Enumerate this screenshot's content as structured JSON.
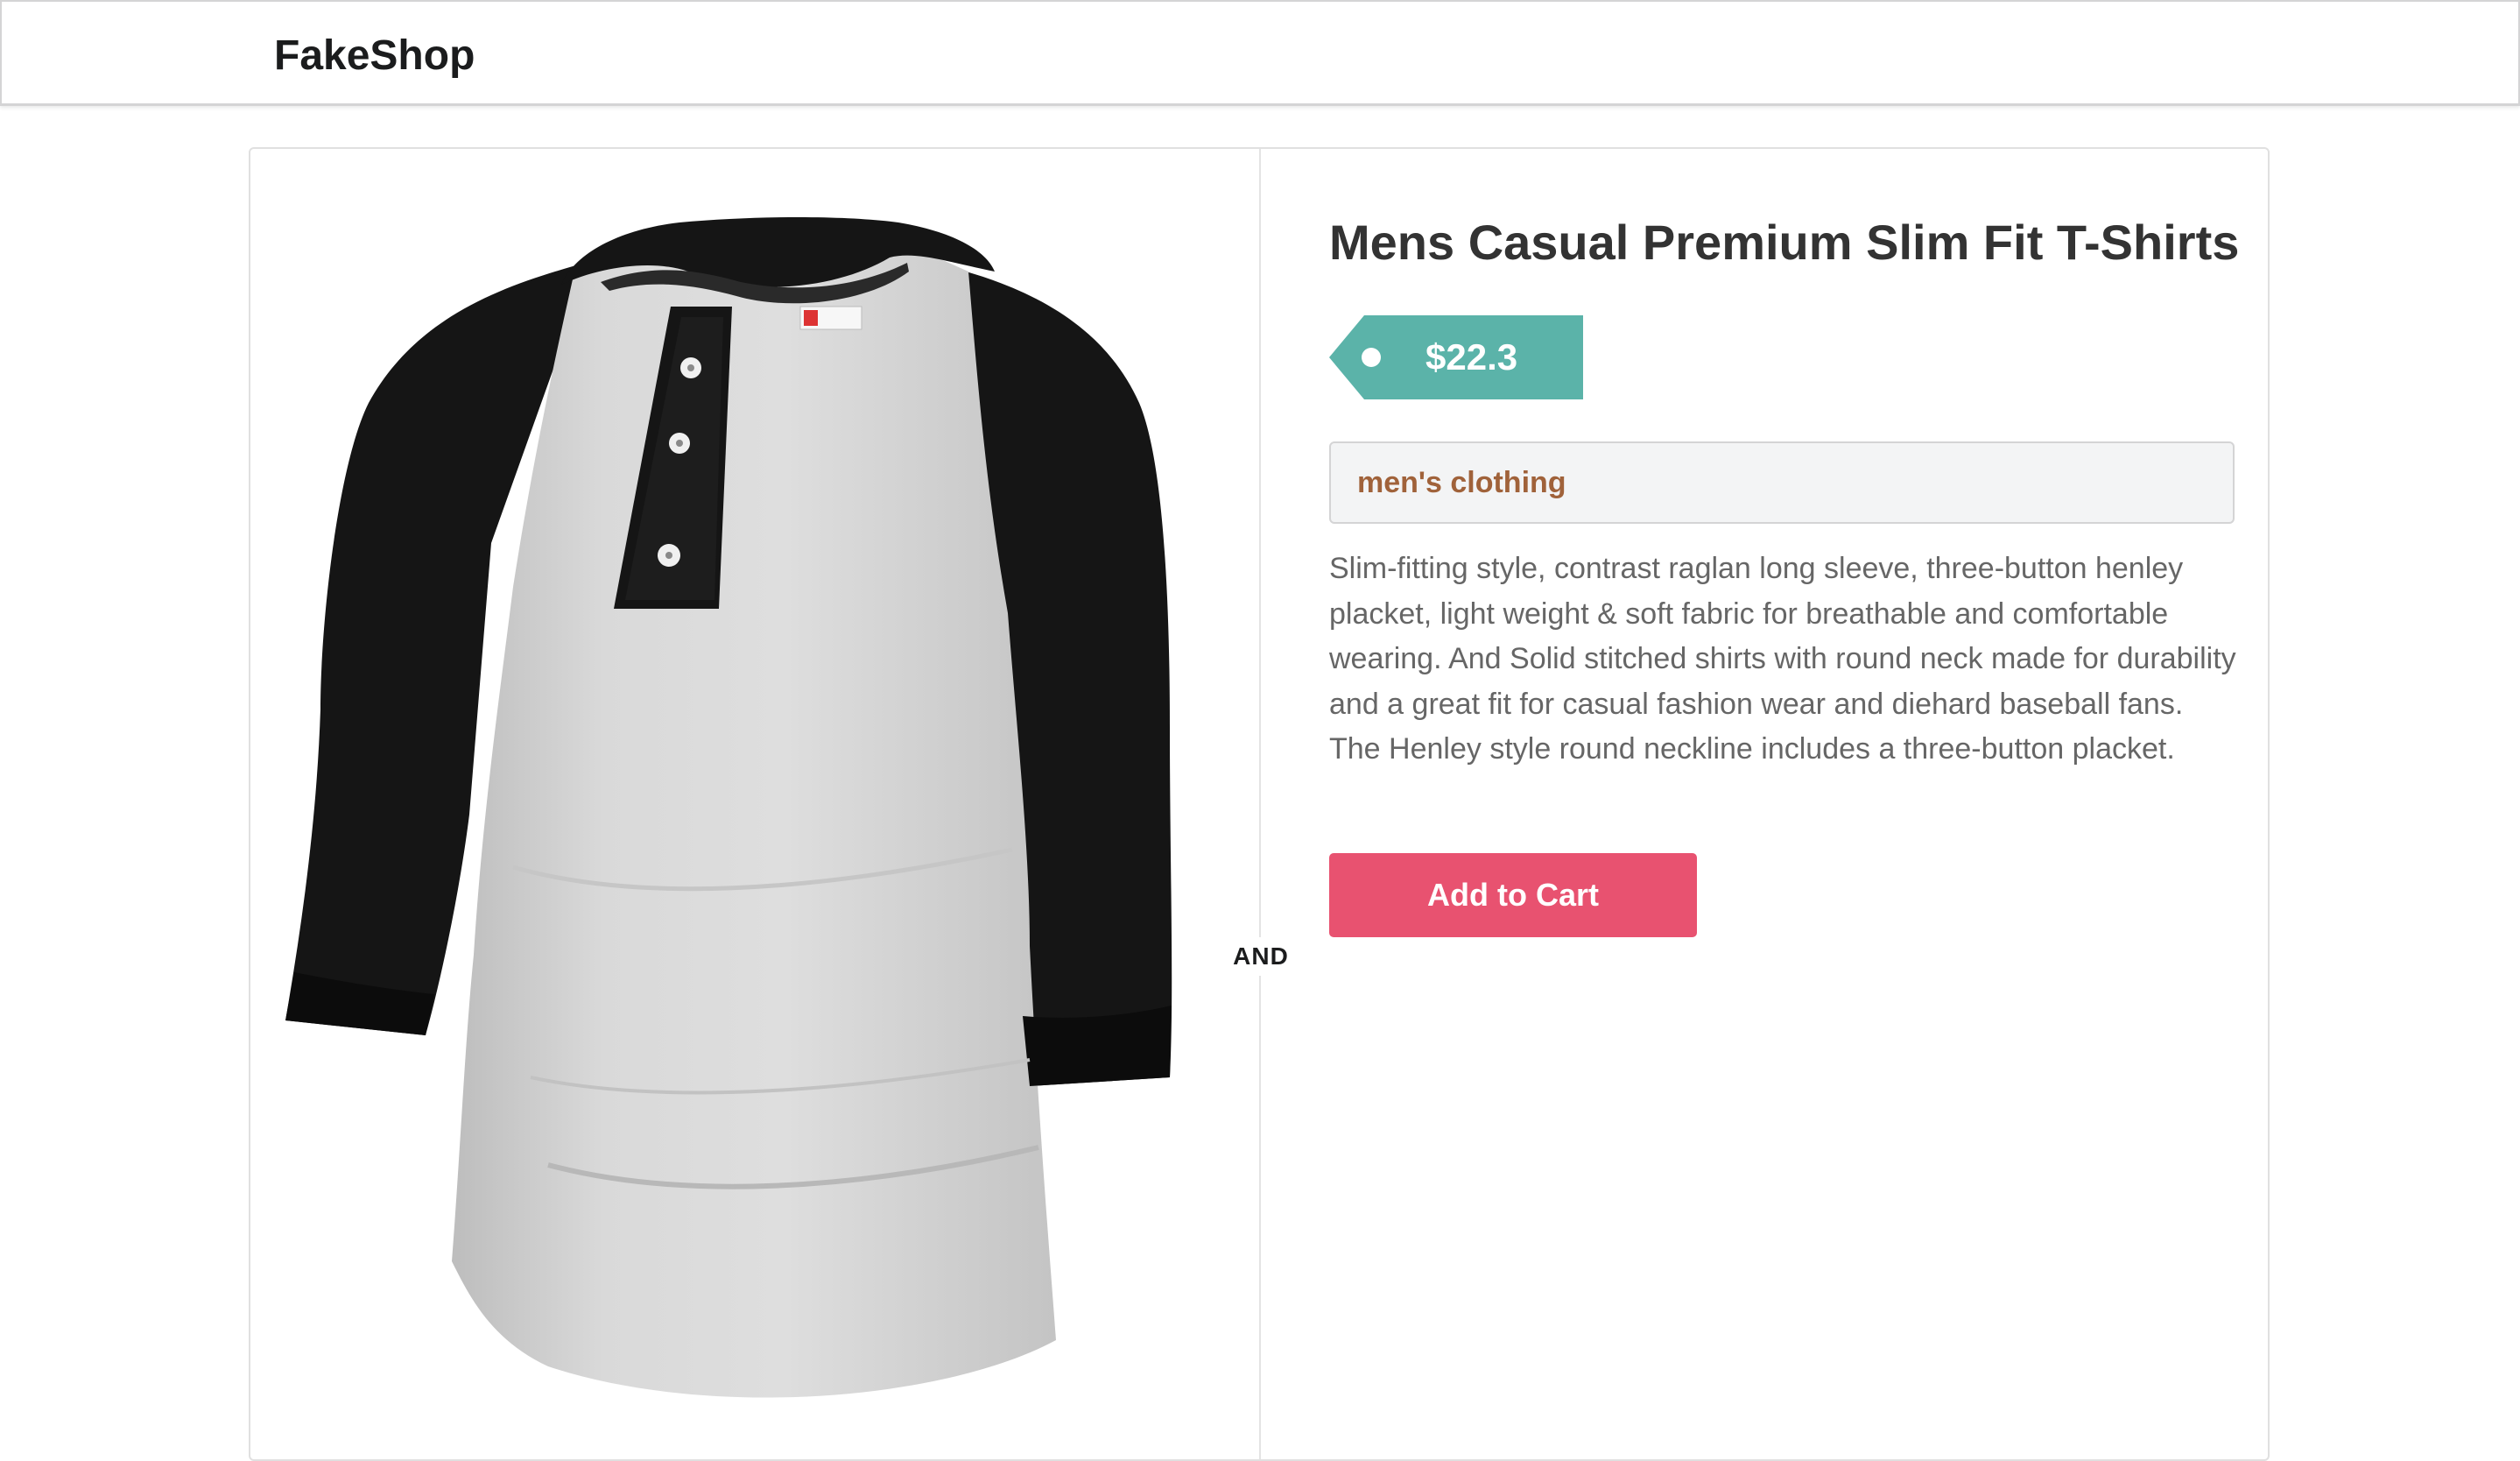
{
  "header": {
    "brand": "FakeShop"
  },
  "product": {
    "title": "Mens Casual Premium Slim Fit T-Shirts",
    "price": "$22.3",
    "category": "men's clothing",
    "description": "Slim-fitting style, contrast raglan long sleeve, three-button henley placket, light weight & soft fabric for breathable and comfortable wearing. And Solid stitched shirts with round neck made for durability and a great fit for casual fashion wear and diehard baseball fans. The Henley style round neckline includes a three-button placket.",
    "image_icon": "raglan-henley-shirt-image",
    "add_to_cart_label": "Add to Cart"
  },
  "divider": {
    "label": "AND"
  },
  "colors": {
    "price_tag": "#5bb3a9",
    "add_to_cart": "#e85270",
    "category_text": "#a0623a",
    "category_bg": "#f3f4f5"
  }
}
